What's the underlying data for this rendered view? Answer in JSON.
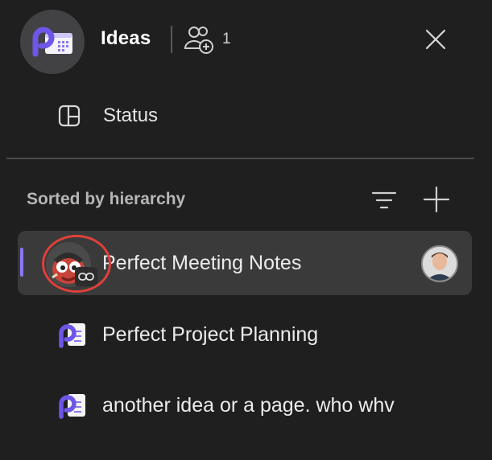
{
  "header": {
    "title": "Ideas",
    "member_count": "1",
    "icons": [
      "workspace-icon",
      "members-add-icon",
      "close-icon"
    ]
  },
  "status": {
    "label": "Status",
    "icon": "board-layout-icon"
  },
  "pages_section": {
    "sort_label": "Sorted by hierarchy",
    "icons": [
      "filter-icon",
      "plus-icon"
    ]
  },
  "pages": [
    {
      "title": "Perfect Meeting Notes",
      "icon": "mascot-avatar-icon",
      "selected": true
    },
    {
      "title": "Perfect Project Planning",
      "icon": "loop-page-icon",
      "selected": false
    },
    {
      "title": "another idea or a page. who whv",
      "icon": "loop-page-icon",
      "selected": false
    }
  ],
  "colors": {
    "background": "#1f1f1f",
    "selected_row": "#3a3a3a",
    "accent": "#8b78f0",
    "annotation_ring": "#e0403a"
  }
}
